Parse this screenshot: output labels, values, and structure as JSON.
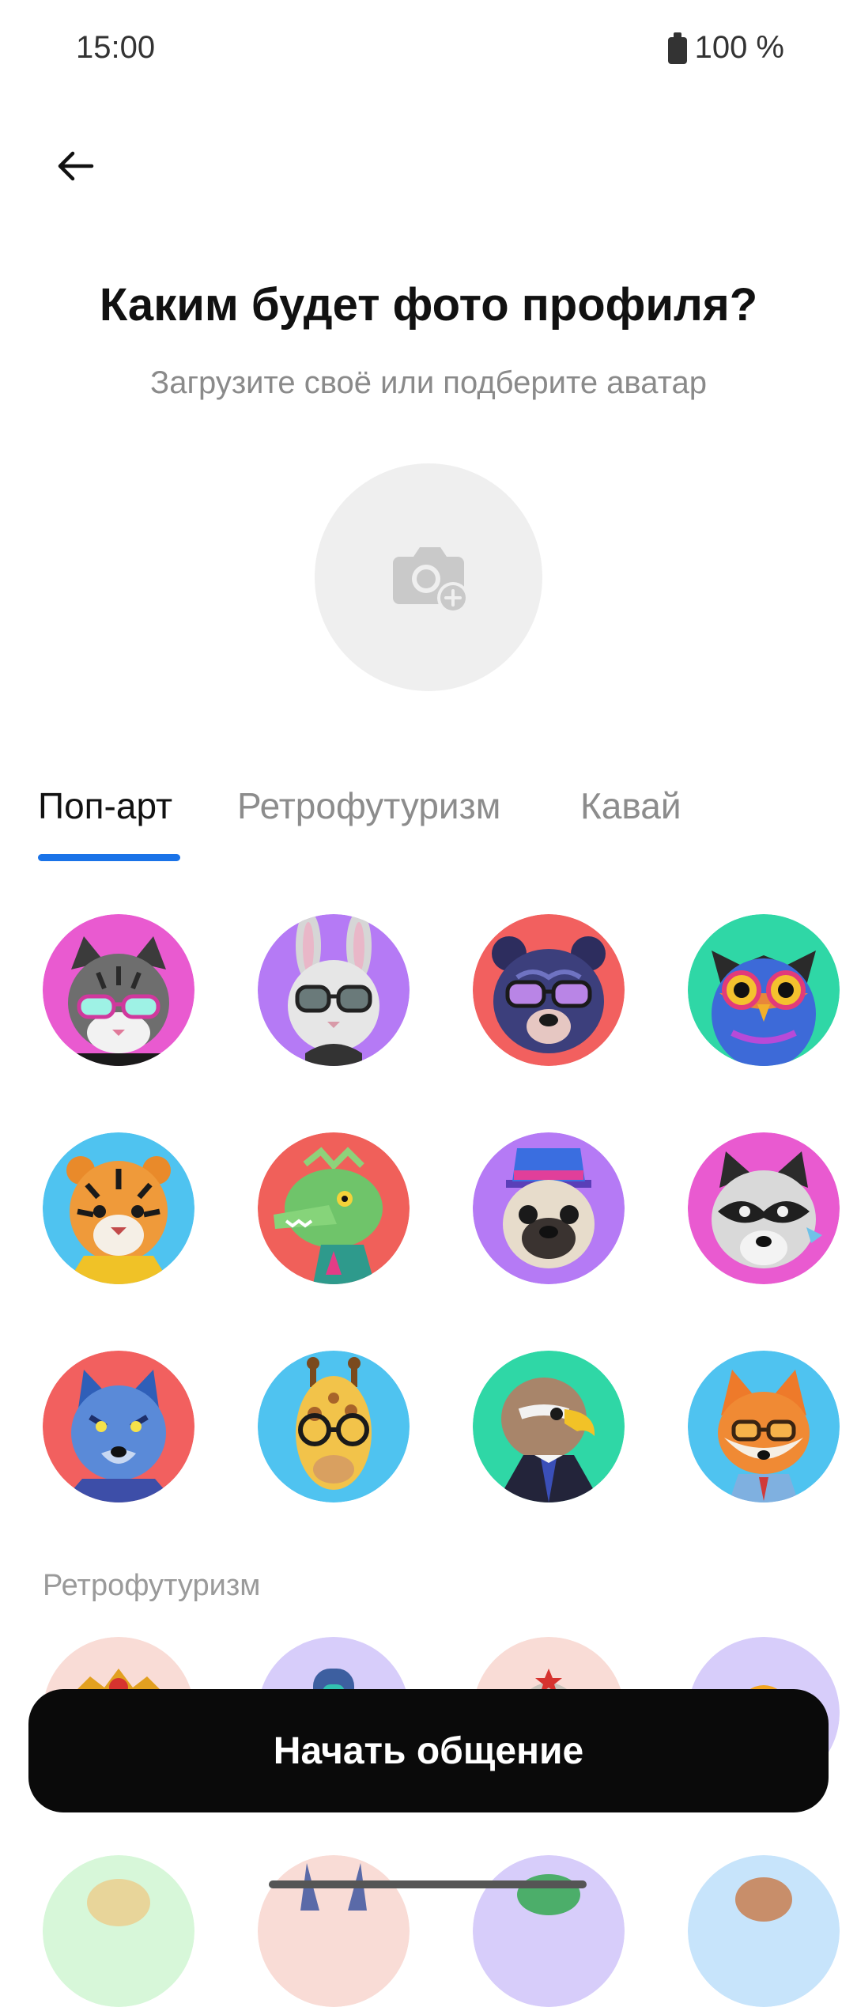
{
  "status_bar": {
    "time": "15:00",
    "battery": "100 %"
  },
  "header": {
    "title": "Каким будет фото профиля?",
    "subtitle": "Загрузите своё или подберите аватар"
  },
  "photo_upload": {
    "icon": "camera-add-icon"
  },
  "tabs": [
    {
      "label": "Поп-арт",
      "active": true
    },
    {
      "label": "Ретрофутуризм",
      "active": false
    },
    {
      "label": "Кавай",
      "active": false
    }
  ],
  "popart_avatars": [
    {
      "name": "cat",
      "bg": "#e95ad0"
    },
    {
      "name": "rabbit",
      "bg": "#b57af5"
    },
    {
      "name": "bear",
      "bg": "#f2605f"
    },
    {
      "name": "owl",
      "bg": "#2fd7a6"
    },
    {
      "name": "tiger",
      "bg": "#4fc3f0"
    },
    {
      "name": "dragon",
      "bg": "#f0605a"
    },
    {
      "name": "pug",
      "bg": "#b57af5"
    },
    {
      "name": "raccoon",
      "bg": "#e95ad0"
    },
    {
      "name": "wolf",
      "bg": "#f2605f"
    },
    {
      "name": "giraffe",
      "bg": "#4fc3f0"
    },
    {
      "name": "eagle",
      "bg": "#2fd7a6"
    },
    {
      "name": "fox",
      "bg": "#4fc3f0"
    }
  ],
  "retro_section": {
    "label": "Ретрофутуризм"
  },
  "retro_avatars": [
    {
      "bg": "#f9dcd6"
    },
    {
      "bg": "#d7cdfa"
    },
    {
      "bg": "#f9dcd6"
    },
    {
      "bg": "#d7cdfa"
    },
    {
      "bg": "#d7f7d9"
    },
    {
      "bg": "#f9dcd6"
    },
    {
      "bg": "#d7cdfa"
    },
    {
      "bg": "#c7e4fb"
    }
  ],
  "cta": {
    "label": "Начать общение"
  },
  "colors": {
    "accent": "#1a73e8",
    "cta_bg": "#0a0a0a"
  }
}
